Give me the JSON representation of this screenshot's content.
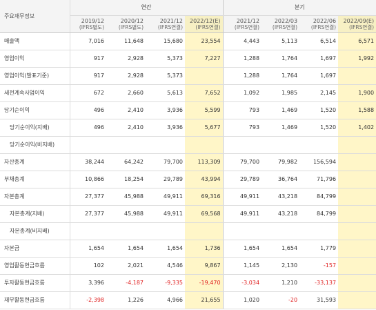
{
  "header": {
    "label": "주요재무정보",
    "annual_title": "연간",
    "quarter_title": "분기",
    "annual_periods": [
      {
        "year": "2019/12",
        "type": "(IFRS별도)"
      },
      {
        "year": "2020/12",
        "type": "(IFRS별도)"
      },
      {
        "year": "2021/12",
        "type": "(IFRS연결)"
      },
      {
        "year": "2022/12(E)",
        "type": "(IFRS연결)"
      }
    ],
    "quarter_periods": [
      {
        "year": "2021/12",
        "type": "(IFRS연결)"
      },
      {
        "year": "2022/03",
        "type": "(IFRS연결)"
      },
      {
        "year": "2022/06",
        "type": "(IFRS연결)"
      },
      {
        "year": "2022/09(E)",
        "type": "(IFRS연결)"
      }
    ],
    "collapse_symbol": "−"
  },
  "rows": [
    {
      "label": "매출액",
      "sub": false,
      "v": [
        "7,016",
        "11,648",
        "15,680",
        "23,554",
        "4,443",
        "5,113",
        "6,514",
        "6,571"
      ]
    },
    {
      "label": "영업이익",
      "sub": false,
      "v": [
        "917",
        "2,928",
        "5,373",
        "7,227",
        "1,288",
        "1,764",
        "1,697",
        "1,992"
      ]
    },
    {
      "label": "영업이익(발표기준)",
      "sub": false,
      "v": [
        "917",
        "2,928",
        "5,373",
        "",
        "1,288",
        "1,764",
        "1,697",
        ""
      ]
    },
    {
      "label": "세전계속사업이익",
      "sub": false,
      "v": [
        "672",
        "2,660",
        "5,613",
        "7,652",
        "1,092",
        "1,985",
        "2,145",
        "1,900"
      ]
    },
    {
      "label": "당기순이익",
      "sub": false,
      "v": [
        "496",
        "2,410",
        "3,936",
        "5,599",
        "793",
        "1,469",
        "1,520",
        "1,588"
      ]
    },
    {
      "label": "당기순이익(지배)",
      "sub": true,
      "v": [
        "496",
        "2,410",
        "3,936",
        "5,677",
        "793",
        "1,469",
        "1,520",
        "1,402"
      ]
    },
    {
      "label": "당기순이익(비지배)",
      "sub": true,
      "v": [
        "",
        "",
        "",
        "",
        "",
        "",
        "",
        ""
      ]
    },
    {
      "label": "자산총계",
      "sub": false,
      "v": [
        "38,244",
        "64,242",
        "79,700",
        "113,309",
        "79,700",
        "79,982",
        "156,594",
        ""
      ]
    },
    {
      "label": "부채총계",
      "sub": false,
      "v": [
        "10,866",
        "18,254",
        "29,789",
        "43,994",
        "29,789",
        "36,764",
        "71,796",
        ""
      ]
    },
    {
      "label": "자본총계",
      "sub": false,
      "v": [
        "27,377",
        "45,988",
        "49,911",
        "69,316",
        "49,911",
        "43,218",
        "84,799",
        ""
      ]
    },
    {
      "label": "자본총계(지배)",
      "sub": true,
      "v": [
        "27,377",
        "45,988",
        "49,911",
        "69,568",
        "49,911",
        "43,218",
        "84,799",
        ""
      ]
    },
    {
      "label": "자본총계(비지배)",
      "sub": true,
      "v": [
        "",
        "",
        "",
        "",
        "",
        "",
        "",
        ""
      ]
    },
    {
      "label": "자본금",
      "sub": false,
      "v": [
        "1,654",
        "1,654",
        "1,654",
        "1,736",
        "1,654",
        "1,654",
        "1,779",
        ""
      ]
    },
    {
      "label": "영업활동현금흐름",
      "sub": false,
      "v": [
        "102",
        "2,021",
        "4,546",
        "9,867",
        "1,145",
        "2,130",
        "-157",
        ""
      ]
    },
    {
      "label": "투자활동현금흐름",
      "sub": false,
      "v": [
        "3,396",
        "-4,187",
        "-9,335",
        "-19,470",
        "-3,034",
        "1,210",
        "-33,137",
        ""
      ]
    },
    {
      "label": "재무활동현금흐름",
      "sub": false,
      "v": [
        "-2,398",
        "1,226",
        "4,966",
        "21,655",
        "1,020",
        "-20",
        "31,593",
        ""
      ]
    }
  ],
  "colors": {
    "negative": "#e02020",
    "estimate_bg": "#fff6c8",
    "header_bg": "#f4f4f4"
  }
}
